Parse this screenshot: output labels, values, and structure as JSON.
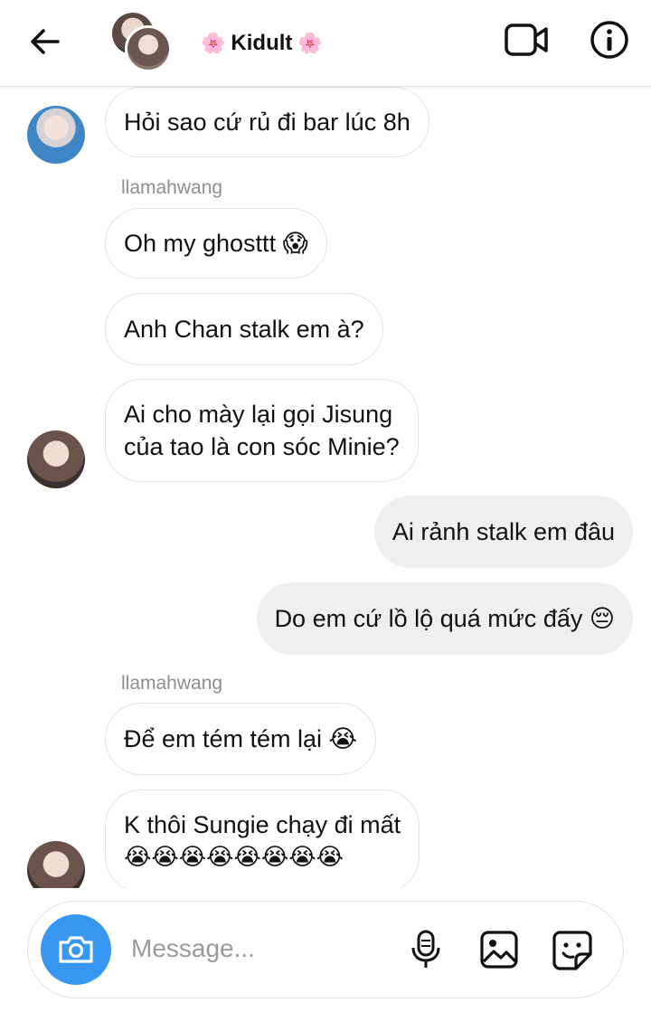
{
  "header": {
    "title": "Kidult",
    "title_decoration": "🌸"
  },
  "messages": [
    {
      "sender": "",
      "direction": "in",
      "text": "Hỏi sao cứ rủ đi bar lúc 8h"
    },
    {
      "sender": "llamahwang",
      "direction": "in",
      "text": "Oh my ghosttt 😱"
    },
    {
      "sender": "llamahwang",
      "direction": "in",
      "text": "Anh Chan stalk em à?"
    },
    {
      "sender": "llamahwang",
      "direction": "in",
      "line1": "Ai cho mày lại gọi Jisung",
      "line2": "của tao là con sóc Minie?"
    },
    {
      "sender": "me",
      "direction": "out",
      "text": "Ai rảnh stalk em đâu"
    },
    {
      "sender": "me",
      "direction": "out",
      "text": "Do em cứ lồ lộ quá mức đấy 😔"
    },
    {
      "sender": "llamahwang",
      "direction": "in",
      "text": "Để em tém tém lại 😭"
    },
    {
      "sender": "llamahwang",
      "direction": "in",
      "line1": "K thôi Sungie chạy đi mất",
      "line2": "😭😭😭😭😭😭😭😭"
    }
  ],
  "sender_label": "llamahwang",
  "composer": {
    "placeholder": "Message..."
  },
  "colors": {
    "accent": "#3897f0",
    "outgoing_bubble": "#efefef",
    "incoming_border": "#e4e4e4"
  }
}
